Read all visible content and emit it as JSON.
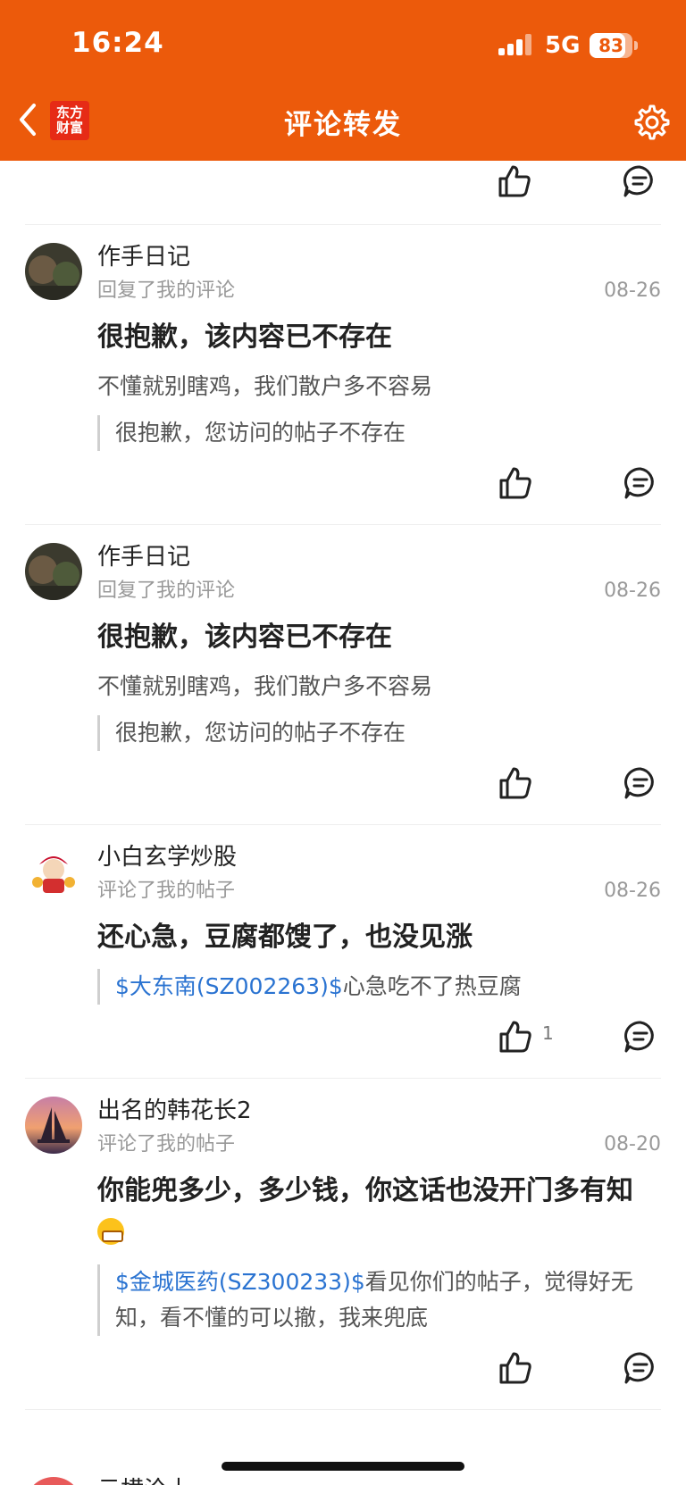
{
  "status_bar": {
    "time": "16:24",
    "network": "5G",
    "battery": "83",
    "battery_level": 0.83
  },
  "header": {
    "title": "评论转发",
    "brand_line1": "东方",
    "brand_line2": "财富"
  },
  "colors": {
    "header_bg": "#ec5a0b",
    "link": "#2a73d1",
    "muted": "#999999"
  },
  "items": [
    {
      "name": "作手日记",
      "action": "回复了我的评论",
      "date": "08-26",
      "main": "很抱歉，该内容已不存在",
      "sub": "不懂就别瞎鸡，我们散户多不容易",
      "quote": "很抱歉，您访问的帖子不存在",
      "likes": ""
    },
    {
      "name": "作手日记",
      "action": "回复了我的评论",
      "date": "08-26",
      "main": "很抱歉，该内容已不存在",
      "sub": "不懂就别瞎鸡，我们散户多不容易",
      "quote": "很抱歉，您访问的帖子不存在",
      "likes": ""
    },
    {
      "name": "小白玄学炒股",
      "action": "评论了我的帖子",
      "date": "08-26",
      "main": "还心急，豆腐都馊了，也没见涨",
      "quote_link": "$大东南(SZ002263)$",
      "quote_text": "心急吃不了热豆腐",
      "likes": "1"
    },
    {
      "name": "出名的韩花长2",
      "action": "评论了我的帖子",
      "date": "08-20",
      "main": "你能兜多少，多少钱，你这话也没开门多有知",
      "quote_link": "$金城医药(SZ300233)$",
      "quote_text": "看见你们的帖子，觉得好无知，看不懂的可以撤，我来兜底",
      "likes": ""
    }
  ],
  "peek": {
    "name": "云横沧土"
  },
  "icons": {
    "back": "chevron-left-icon",
    "settings": "gear-icon",
    "like": "thumbs-up-icon",
    "reply": "comment-icon",
    "emoji": "grin-emoji-icon"
  }
}
